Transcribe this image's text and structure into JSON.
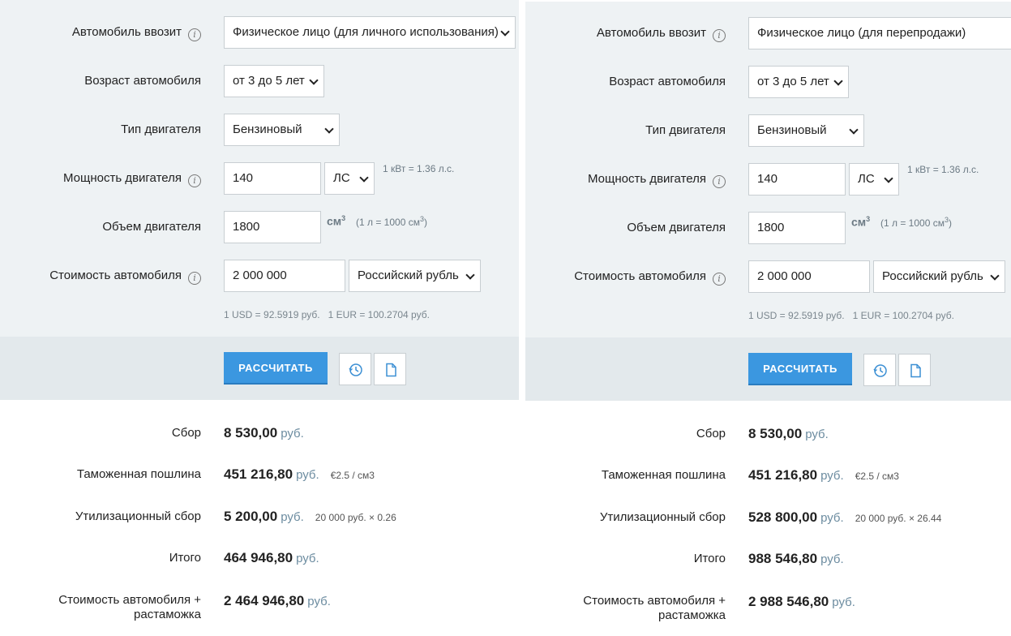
{
  "left": {
    "importer_label": "Автомобиль ввозит",
    "importer_value": "Физическое лицо (для личного использования)",
    "age_label": "Возраст автомобиля",
    "age_value": "от 3 до 5 лет",
    "engine_type_label": "Тип двигателя",
    "engine_type_value": "Бензиновый",
    "power_label": "Мощность двигателя",
    "power_value": "140",
    "power_unit": "ЛС",
    "power_note": "1 кВт = 1.36 л.с.",
    "volume_label": "Объем двигателя",
    "volume_value": "1800",
    "volume_unit": "см",
    "volume_note_a": "(1 л = 1000 см",
    "volume_note_b": ")",
    "sup3": "3",
    "price_label": "Стоимость автомобиля",
    "price_value": "2 000 000",
    "currency_value": "Российский рубль",
    "rates_usd": "1 USD = 92.5919 руб.",
    "rates_eur": "1 EUR = 100.2704 руб.",
    "calc_button": "РАССЧИТАТЬ",
    "results": {
      "fee_label": "Сбор",
      "fee_value": "8 530,00",
      "duty_label": "Таможенная пошлина",
      "duty_value": "451 216,80",
      "duty_extra": "€2.5 / см3",
      "util_label": "Утилизационный сбор",
      "util_value": "5 200,00",
      "util_extra": "20 000 руб. × 0.26",
      "total_label": "Итого",
      "total_value": "464 946,80",
      "grand_label_1": "Стоимость автомобиля +",
      "grand_label_2": "растаможка",
      "grand_value": "2 464 946,80",
      "currency": "руб."
    }
  },
  "right": {
    "importer_label": "Автомобиль ввозит",
    "importer_value": "Физическое лицо (для перепродажи)",
    "age_label": "Возраст автомобиля",
    "age_value": "от 3 до 5 лет",
    "engine_type_label": "Тип двигателя",
    "engine_type_value": "Бензиновый",
    "power_label": "Мощность двигателя",
    "power_value": "140",
    "power_unit": "ЛС",
    "power_note": "1 кВт = 1.36 л.с.",
    "volume_label": "Объем двигателя",
    "volume_value": "1800",
    "volume_unit": "см",
    "volume_note_a": "(1 л = 1000 см",
    "volume_note_b": ")",
    "sup3": "3",
    "price_label": "Стоимость автомобиля",
    "price_value": "2 000 000",
    "currency_value": "Российский рубль",
    "rates_usd": "1 USD = 92.5919 руб.",
    "rates_eur": "1 EUR = 100.2704 руб.",
    "calc_button": "РАССЧИТАТЬ",
    "results": {
      "fee_label": "Сбор",
      "fee_value": "8 530,00",
      "duty_label": "Таможенная пошлина",
      "duty_value": "451 216,80",
      "duty_extra": "€2.5 / см3",
      "util_label": "Утилизационный сбор",
      "util_value": "528 800,00",
      "util_extra": "20 000 руб. × 26.44",
      "total_label": "Итого",
      "total_value": "988 546,80",
      "grand_label_1": "Стоимость автомобиля +",
      "grand_label_2": "растаможка",
      "grand_value": "2 988 546,80",
      "currency": "руб."
    }
  },
  "icons": {
    "info": "i",
    "history": "clock-icon",
    "document": "document-icon"
  }
}
